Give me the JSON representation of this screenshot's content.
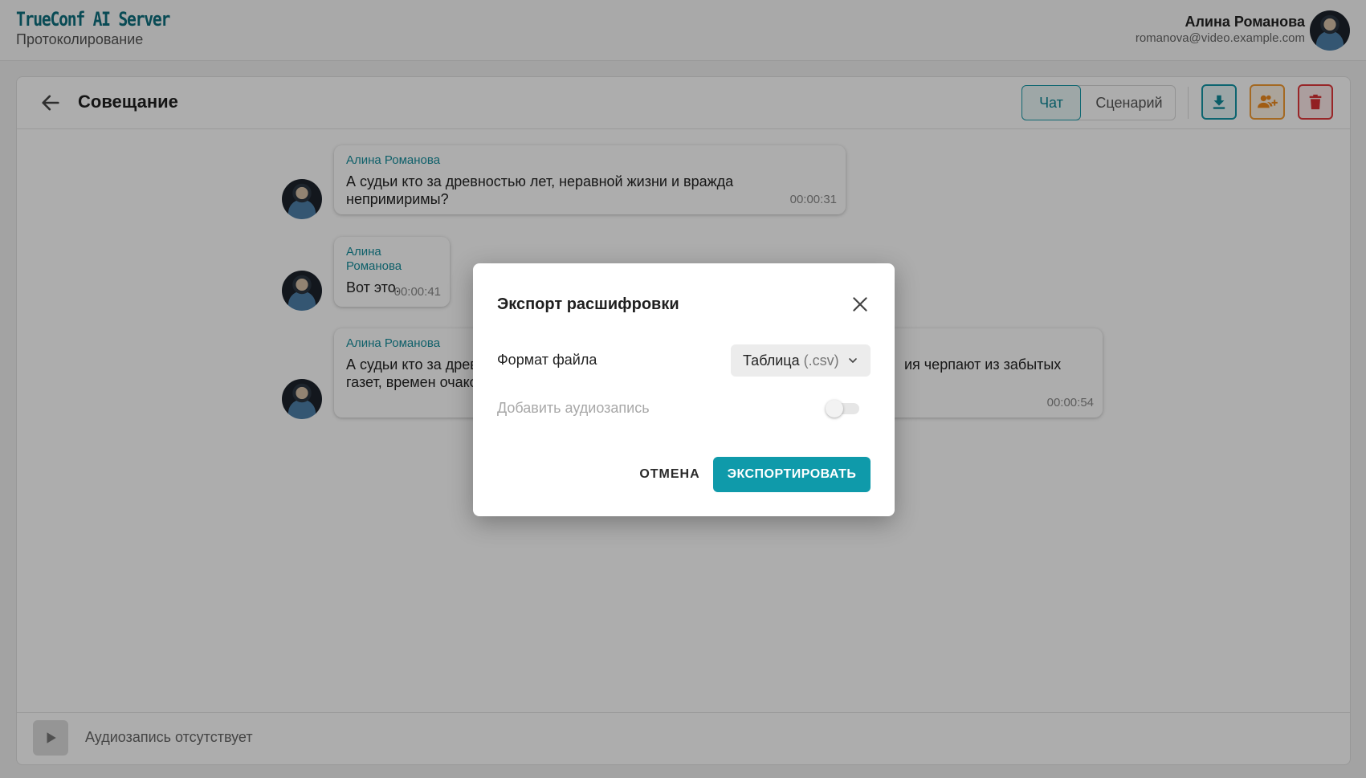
{
  "header": {
    "brand": "TrueConf AI Server",
    "subtitle": "Протоколирование",
    "user_name": "Алина Романова",
    "user_email": "romanova@video.example.com"
  },
  "meeting": {
    "title": "Совещание",
    "tabs": [
      {
        "label": "Чат",
        "active": true
      },
      {
        "label": "Сценарий",
        "active": false
      }
    ],
    "actions": [
      "download-icon",
      "add-user-icon",
      "trash-icon"
    ]
  },
  "messages": [
    {
      "author": "Алина Романова",
      "text": "А судьи кто за древностью лет, неравной жизни и вражда непримиримы?",
      "time": "00:00:31"
    },
    {
      "author": "Алина Романова",
      "text": "Вот это.",
      "time": "00:00:41"
    },
    {
      "author": "Алина Романова",
      "text_line1": "А судьи кто за древ",
      "text_line1_end": "ия черпают из забытых",
      "text_line2": "газет, времен очако",
      "time": "00:00:54"
    }
  ],
  "player": {
    "status": "Аудиозапись отсутствует"
  },
  "dialog": {
    "title": "Экспорт расшифровки",
    "format_label": "Формат файла",
    "format_value": "Таблица",
    "format_ext": "(.csv)",
    "audio_label": "Добавить аудиозапись",
    "audio_enabled": false,
    "cancel_label": "ОТМЕНА",
    "export_label": "ЭКСПОРТИРОВАТЬ"
  },
  "colors": {
    "accent": "#0f9aaa",
    "warning": "#f29b33",
    "danger": "#e0383b"
  }
}
